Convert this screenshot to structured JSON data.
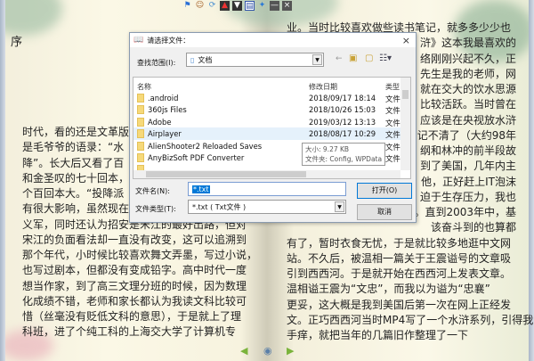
{
  "toolbar": {
    "icons": [
      "flag-icon",
      "character-icon",
      "refresh-icon",
      "up-icon",
      "down-icon",
      "book-icon",
      "pin-icon",
      "minimize-icon",
      "close-icon"
    ],
    "labels": {
      "minimize": "—",
      "close": "×"
    }
  },
  "left_page": {
    "heading": "序",
    "lines": [
      "时代，看的还是文革版",
      "是毛爷爷的语录：“水",
      "降”。长大后又看了百",
      "和金圣叹的七十回本，",
      "个百回本大。“投降派",
      "有很大影响，虽然现在",
      "义军，同时还认为招安是宋江的最好出路，但对",
      "宋江的负面看法却一直没有改变，这可以追溯到",
      "那个年代，小时候比较喜欢舞文弄墨，写过小说，",
      "也写过剧本，但都没有变成铅字。高中时代一度",
      "想当作家，到了高三文理分班的时候，因为数理",
      "化成绩不错，老师和家长都认为我读文科比较可",
      "惜（丝毫没有贬低文科的意思），于是就上了理",
      "科班，进了个纯工科的上海交大学了计算机专"
    ]
  },
  "right_page": {
    "lines": [
      "业。当时比较喜欢做些读书笔记，就多多少少也",
      "浒》这本我最喜欢的",
      "络刚刚兴起不久，正",
      "先生是我的老师，网",
      "就在交大的饮水思源",
      "比较活跃。当时曾在",
      "应该是在央视放水浒",
      "记不清了（大约98年",
      "纲和林冲的前半段故",
      "到了美国，几年内主",
      "他，正好赶上IT泡沫",
      "迫于生存压力，我也",
      "。直到2003年中，基",
      "该奋斗到的也算都",
      "有了，暂时衣食无忧，于是就比较多地逛中文网",
      "站。不久后，被温相一篇关于王震谥号的文章吸",
      "引到西西河。于是就开始在西西河上发表文章。",
      "温相谥王震为“文忠”，而我以为谥为“忠襄”",
      "更妥，这大概是我到美国后第一次在网上正经发",
      "文。正巧西西河当时MP4写了一个水浒系列，引得我",
      "手痒，就把当年的几篇旧作整理了一下"
    ]
  },
  "dialog": {
    "title": "请选择文件：",
    "close": "×",
    "look_in_label": "查找范围(I):",
    "look_in_value": "文档",
    "columns": [
      "名称",
      "修改日期",
      "类型"
    ],
    "files": [
      {
        "name": ".android",
        "date": "2018/09/17 18:14",
        "type": "文件"
      },
      {
        "name": "360js Files",
        "date": "2018/10/26 15:03",
        "type": "文件"
      },
      {
        "name": "Adobe",
        "date": "2019/03/12 13:13",
        "type": "文件"
      },
      {
        "name": "Airplayer",
        "date": "2018/08/17 10:29",
        "type": "文件"
      },
      {
        "name": "AlienShooter2 Reloaded Saves",
        "date": "",
        "type": "文件"
      },
      {
        "name": "AnyBizSoft PDF Converter",
        "date": "",
        "type": "文件"
      }
    ],
    "tooltip": {
      "size": "大小: 9.27 KB",
      "folders": "文件夹: Config, WPData"
    },
    "filename_label": "文件名(N):",
    "filename_value": "*.txt",
    "filetype_label": "文件类型(T):",
    "filetype_value": "*.txt ( Txt文件 )",
    "open_button": "打开(O)",
    "cancel_button": "取消"
  },
  "nav": {
    "prev": "◀",
    "home": "◉",
    "next": "▶"
  }
}
